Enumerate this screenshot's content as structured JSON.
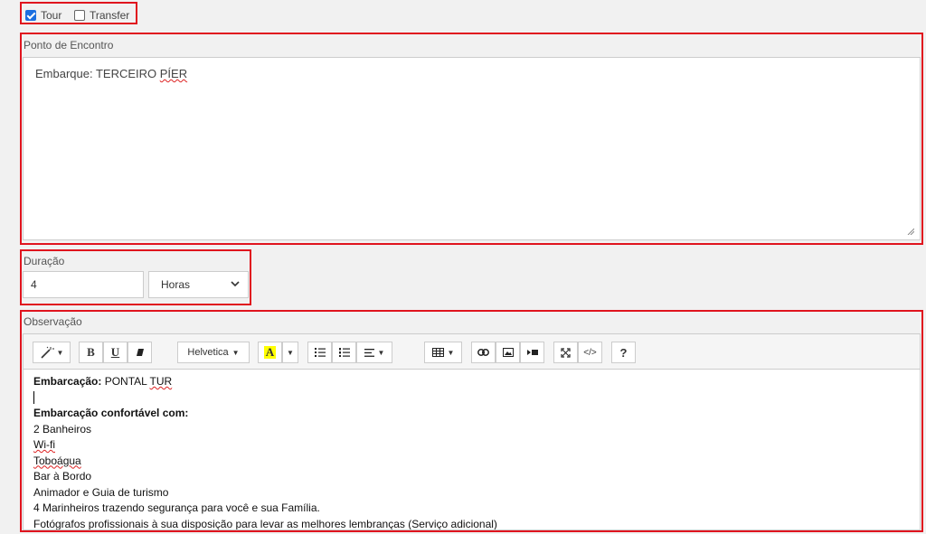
{
  "type_options": {
    "tour": {
      "label": "Tour",
      "checked": true
    },
    "transfer": {
      "label": "Transfer",
      "checked": false
    }
  },
  "meeting_point": {
    "label": "Ponto de Encontro",
    "value_prefix": "Embarque: TERCEIRO ",
    "value_misspelled": "PÍER"
  },
  "duration": {
    "label": "Duração",
    "value": "4",
    "unit_selected": "Horas"
  },
  "notes": {
    "label": "Observação",
    "toolbar": {
      "style_icon": "magic-wand-icon",
      "bold": "B",
      "underline": "U",
      "eraser_icon": "eraser-icon",
      "font_name": "Helvetica",
      "color_letter": "A",
      "highlight_color": "#ffff00",
      "ul_icon": "unordered-list-icon",
      "ol_icon": "ordered-list-icon",
      "align_icon": "align-icon",
      "table_icon": "table-icon",
      "link_icon": "link-icon",
      "picture_icon": "picture-icon",
      "video_icon": "video-icon",
      "fullscreen_icon": "fullscreen-icon",
      "codeview": "</>",
      "help": "?"
    },
    "content": {
      "vessel_label": "Embarcação:",
      "vessel_name_prefix": " PONTAL ",
      "vessel_name_misspelled": "TUR",
      "comfort_heading": "Embarcação confortável com:",
      "line_1": "2 Banheiros",
      "line_2": "Wi-fi",
      "line_3": "Toboágua",
      "line_4": "Bar à Bordo",
      "line_5": "Animador e Guia de turismo",
      "line_6": "4 Marinheiros trazendo segurança para você e sua Família.",
      "line_7": "Fotógrafos profissionais à sua disposição para levar as melhores lembranças (Serviço adicional)"
    }
  },
  "colors": {
    "highlight_border": "#e0141e",
    "checkbox_checked": "#1b6fe0",
    "page_background": "#f1f1f1"
  }
}
